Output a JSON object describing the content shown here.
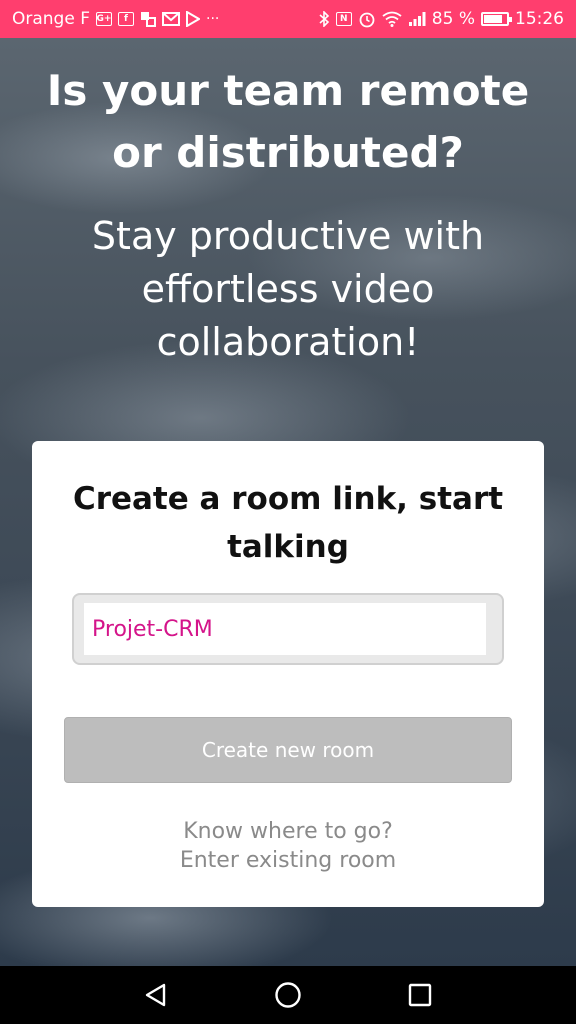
{
  "status_bar": {
    "carrier": "Orange F",
    "battery": "85 %",
    "battery_level": 0.85,
    "time": "15:26",
    "icons_left": [
      "google-plus-icon",
      "facebook-icon",
      "app-icon",
      "gmail-icon",
      "play-store-icon",
      "more-icon"
    ],
    "icons_right": [
      "bluetooth-icon",
      "nfc-icon",
      "alarm-icon",
      "wifi-icon",
      "signal-icon",
      "battery-icon"
    ]
  },
  "headline": {
    "line1": "Is your team remote",
    "line2": "or distributed?"
  },
  "subheadline": {
    "line1": "Stay productive with",
    "line2": "effortless video",
    "line3": "collaboration!"
  },
  "card": {
    "title_line1": "Create a room link, start",
    "title_line2": "talking",
    "room_input_value": "Projet-CRM",
    "create_button_label": "Create new room",
    "existing_line1": "Know where to go?",
    "existing_line2": "Enter existing room"
  },
  "colors": {
    "status_bar": "#ff3e6e",
    "input_text": "#d4148a",
    "button_bg": "#bdbdbd"
  }
}
